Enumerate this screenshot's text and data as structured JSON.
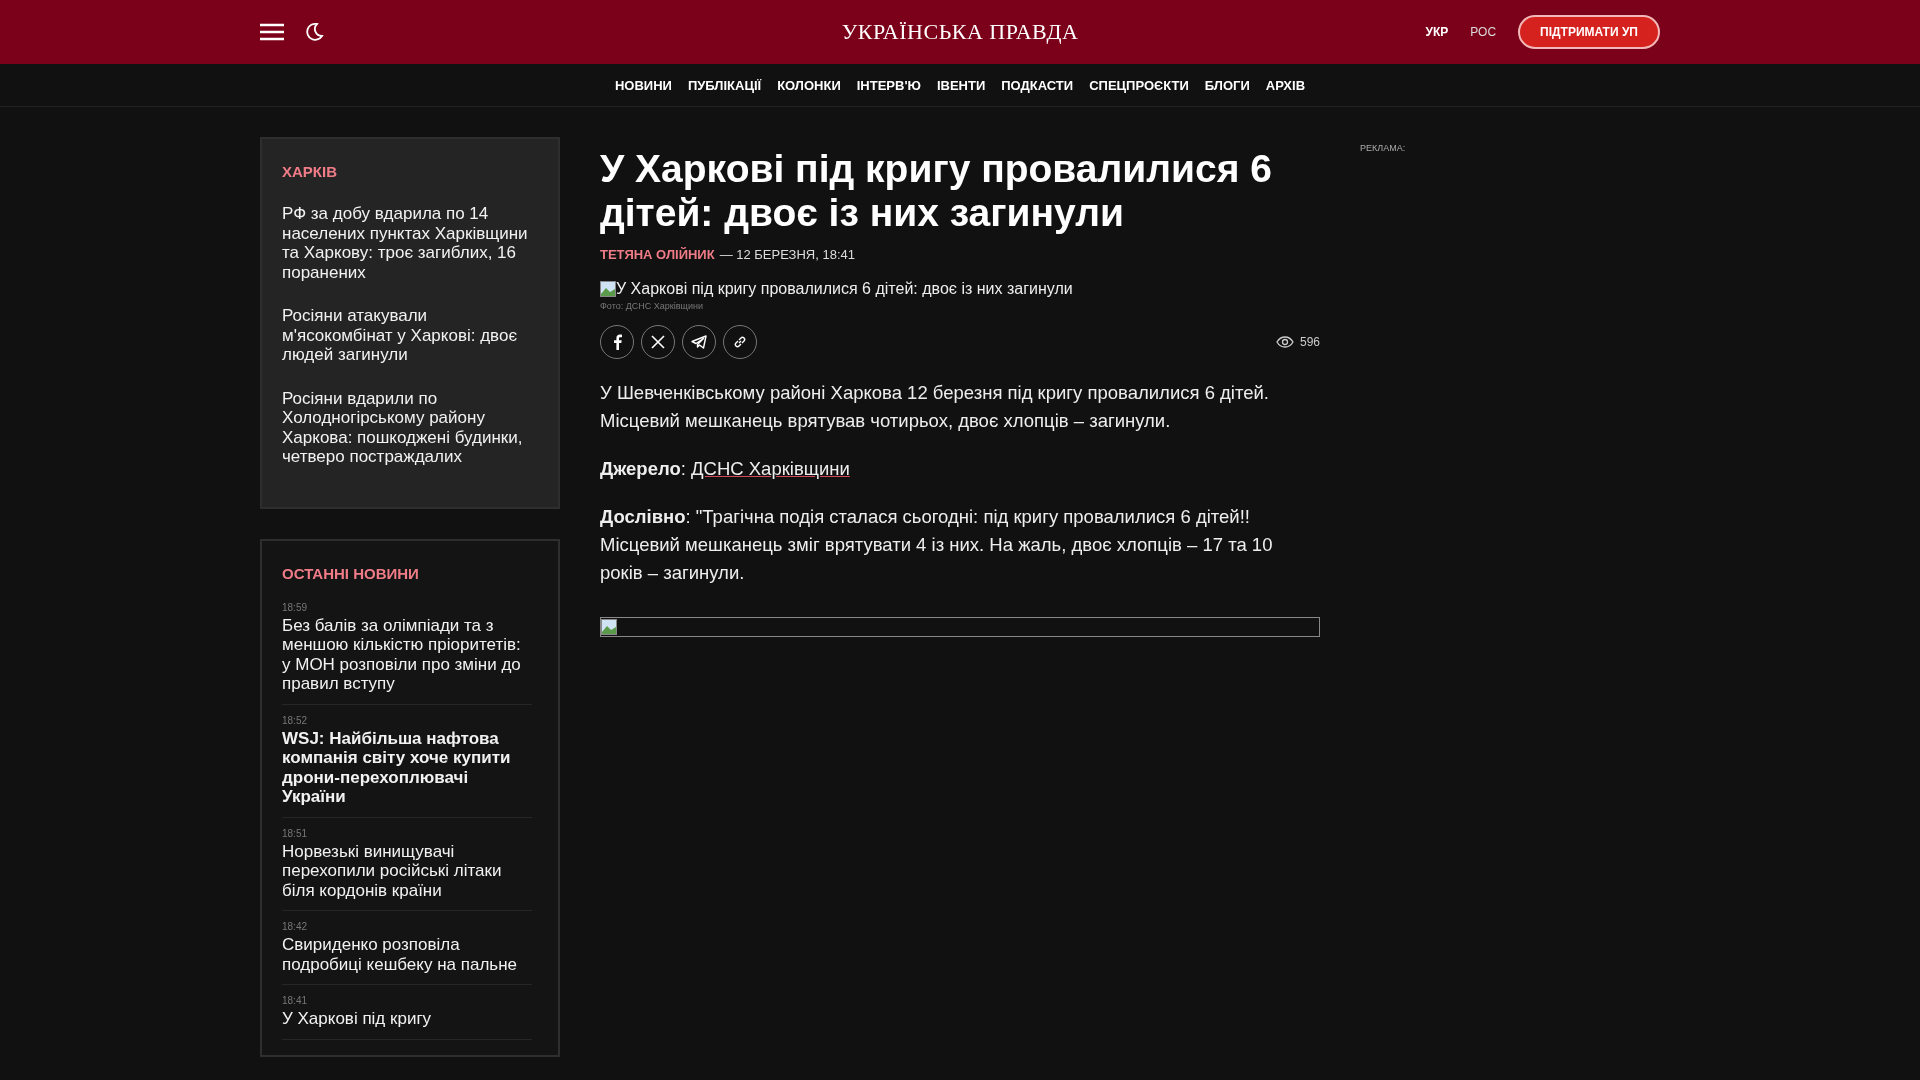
{
  "header": {
    "logo": "УКРАЇНСЬКА ПРАВДА",
    "languages": [
      {
        "label": "УКР",
        "selected": true
      },
      {
        "label": "РОС",
        "selected": false
      }
    ],
    "support_button": "ПІДТРИМАТИ УП"
  },
  "nav": [
    "НОВИНИ",
    "ПУБЛІКАЦІЇ",
    "КОЛОНКИ",
    "ІНТЕРВ'Ю",
    "ІВЕНТИ",
    "ПОДКАСТИ",
    "СПЕЦПРОЄКТИ",
    "БЛОГИ",
    "АРХІВ"
  ],
  "region_block": {
    "title": "ХАРКІВ",
    "items": [
      "РФ за добу вдарила по 14 населених пунктах Харківщини та Харкову: троє загиблих, 16 поранених",
      "Росіяни атакували м'ясокомбінат у Харкові: двоє людей загинули",
      "Росіяни вдарили по Холодногірському району Харкова: пошкоджені будинки, четверо постраждалих"
    ]
  },
  "latest_news": {
    "title": "ОСТАННІ НОВИНИ",
    "items": [
      {
        "time": "18:59",
        "title": "Без балів за олімпіади та з меншою кількістю пріоритетів: у МОН розповіли про зміни до правил вступу",
        "bold": false
      },
      {
        "time": "18:52",
        "title": "WSJ: Найбільша нафтова компанія світу хоче купити дрони-перехоплювачі України",
        "bold": true
      },
      {
        "time": "18:51",
        "title": "Норвезькі винищувачі перехопили російські літаки біля кордонів країни",
        "bold": false
      },
      {
        "time": "18:42",
        "title": "Свириденко розповіла подробиці кешбеку на пальне",
        "bold": false
      },
      {
        "time": "18:41",
        "title": "У Харкові під кригу",
        "bold": false
      }
    ]
  },
  "article": {
    "title": "У Харкові під кригу провалилися 6 дітей: двоє із них загинули",
    "author": "ТЕТЯНА ОЛІЙНИК",
    "date": "— 12 БЕРЕЗНЯ, 18:41",
    "image_alt": "У Харкові під кригу провалилися 6 дітей: двоє із них загинули",
    "photo_credit": "Фото: ДСНС Харківщини",
    "views": "596",
    "paragraphs": [
      {
        "kind": "text",
        "text": "У Шевченківському районі Харкова 12 березня під кригу провалилися 6 дітей. Місцевий мешканець врятував чотирьох, двоє хлопців – загинули."
      },
      {
        "kind": "source",
        "text": "**Джерело**: ",
        "link": "ДСНС Харківщини"
      },
      {
        "kind": "text",
        "text": "**Дослівно**: \"Трагічна подія сталася сьогодні: під кригу провалилися 6 дітей!! Місцевий мешканець зміг врятувати 4 із них. На жаль, двоє хлопців – 17 та 10 років – загинули."
      }
    ]
  },
  "ad_label": "РЕКЛАМА:"
}
